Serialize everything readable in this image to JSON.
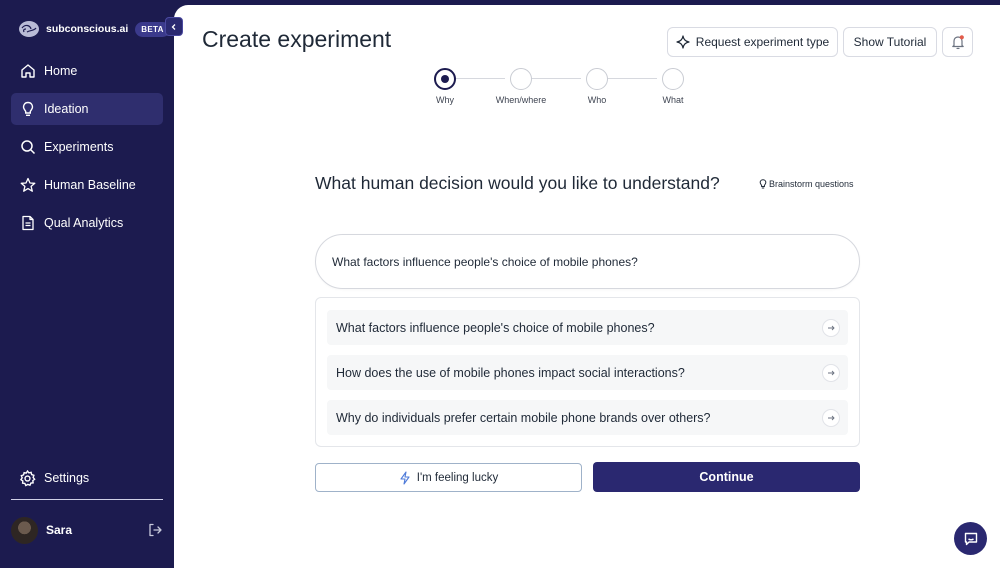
{
  "brand": {
    "name": "subconscious.ai",
    "badge": "BETA"
  },
  "sidebar": {
    "items": [
      {
        "label": "Home",
        "icon": "home-icon"
      },
      {
        "label": "Ideation",
        "icon": "lightbulb-icon",
        "active": true
      },
      {
        "label": "Experiments",
        "icon": "search-icon"
      },
      {
        "label": "Human Baseline",
        "icon": "star-icon"
      },
      {
        "label": "Qual Analytics",
        "icon": "document-icon"
      }
    ],
    "settings": {
      "label": "Settings",
      "icon": "gear-icon"
    },
    "user": {
      "name": "Sara"
    }
  },
  "header": {
    "title": "Create experiment",
    "request_label": "Request experiment type",
    "tutorial_label": "Show Tutorial"
  },
  "stepper": {
    "steps": [
      {
        "label": "Why",
        "active": true
      },
      {
        "label": "When/where",
        "active": false
      },
      {
        "label": "Who",
        "active": false
      },
      {
        "label": "What",
        "active": false
      }
    ]
  },
  "form": {
    "question": "What human decision would you like to understand?",
    "brainstorm_label": "Brainstorm questions",
    "input_value": "What factors influence people's choice of mobile phones?",
    "suggestions": [
      "What factors influence people's choice of mobile phones?",
      "How does the use of mobile phones impact social interactions?",
      "Why do individuals prefer certain mobile phone brands over others?"
    ],
    "lucky_label": "I'm feeling lucky",
    "continue_label": "Continue"
  },
  "colors": {
    "sidebar_bg": "#1c1b4f",
    "primary": "#2a2870",
    "active_nav": "#2f2e6e"
  }
}
